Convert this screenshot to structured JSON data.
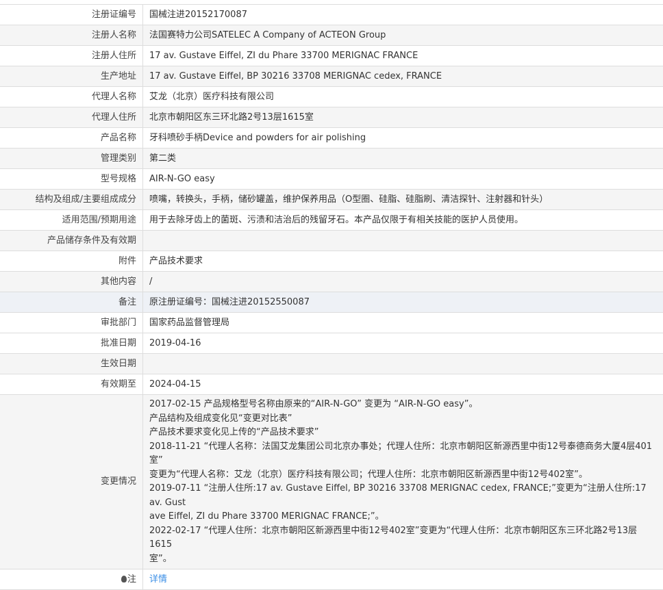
{
  "rows": [
    {
      "label": "注册证编号",
      "value": "国械注进20152170087"
    },
    {
      "label": "注册人名称",
      "value": "法国赛特力公司SATELEC A Company of ACTEON Group"
    },
    {
      "label": "注册人住所",
      "value": "17 av. Gustave Eiffel, ZI du Phare 33700 MERIGNAC FRANCE"
    },
    {
      "label": "生产地址",
      "value": "17 av. Gustave Eiffel, BP 30216 33708 MERIGNAC cedex, FRANCE"
    },
    {
      "label": "代理人名称",
      "value": "艾龙（北京）医疗科技有限公司"
    },
    {
      "label": "代理人住所",
      "value": "北京市朝阳区东三环北路2号13层1615室"
    },
    {
      "label": "产品名称",
      "value": "牙科喷砂手柄Device and powders for air polishing"
    },
    {
      "label": "管理类别",
      "value": "第二类"
    },
    {
      "label": "型号规格",
      "value": "AIR-N-GO easy"
    },
    {
      "label": "结构及组成/主要组成成分",
      "value": "喷嘴，转换头，手柄，储砂罐盖，维护保养用品（O型圈、硅脂、硅脂刷、清洁探针、注射器和针头）"
    },
    {
      "label": "适用范围/预期用途",
      "value": "用于去除牙齿上的菌斑、污渍和洁治后的残留牙石。本产品仅限于有相关技能的医护人员使用。"
    },
    {
      "label": "产品储存条件及有效期",
      "value": ""
    },
    {
      "label": "附件",
      "value": "产品技术要求"
    },
    {
      "label": "其他内容",
      "value": "/"
    },
    {
      "label": "备注",
      "value": "原注册证编号：国械注进20152550087"
    },
    {
      "label": "审批部门",
      "value": "国家药品监督管理局"
    },
    {
      "label": "批准日期",
      "value": "2019-04-16"
    },
    {
      "label": "生效日期",
      "value": ""
    },
    {
      "label": "有效期至",
      "value": "2024-04-15"
    }
  ],
  "changes": {
    "label": "变更情况",
    "lines": [
      "2017-02-15 产品规格型号名称由原来的“AIR-N-GO” 变更为 “AIR-N-GO easy”。",
      "产品结构及组成变化见“变更对比表”",
      "产品技术要求变化见上传的“产品技术要求”",
      "2018-11-21 “代理人名称：法国艾龙集团公司北京办事处；代理人住所：北京市朝阳区新源西里中街12号泰德商务大厦4层401室”",
      "变更为“代理人名称：艾龙（北京）医疗科技有限公司；代理人住所：北京市朝阳区新源西里中街12号402室”。",
      "2019-07-11 “注册人住所:17 av. Gustave Eiffel, BP 30216 33708 MERIGNAC cedex, FRANCE;”变更为“注册人住所:17 av. Gust",
      "ave Eiffel, ZI du Phare 33700 MERIGNAC FRANCE;”。",
      "2022-02-17 “代理人住所：北京市朝阳区新源西里中街12号402室”变更为“代理人住所：北京市朝阳区东三环北路2号13层1615",
      "室”。"
    ]
  },
  "note": {
    "label": "注",
    "link": "详情"
  }
}
